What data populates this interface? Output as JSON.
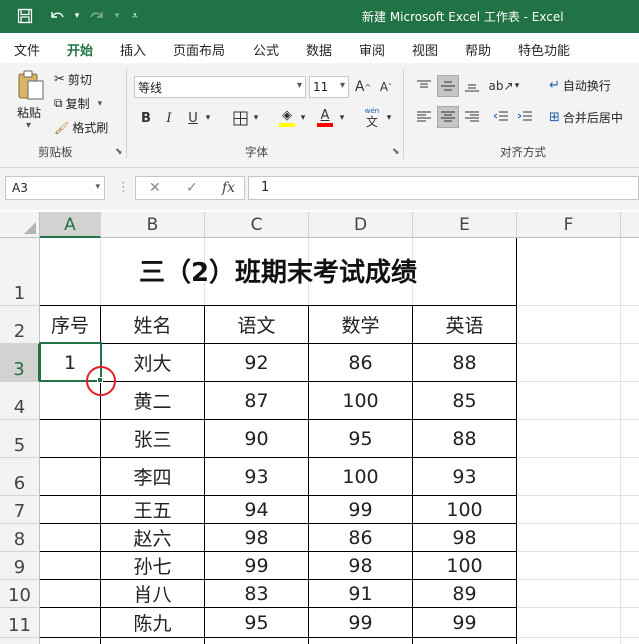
{
  "window": {
    "title": "新建 Microsoft Excel 工作表  -  Excel",
    "qat": {
      "save_icon": "save-icon",
      "undo_icon": "undo-icon",
      "redo_icon": "redo-icon",
      "more_icon": "customize-qat-icon"
    }
  },
  "menu": {
    "tabs": [
      "文件",
      "开始",
      "插入",
      "页面布局",
      "公式",
      "数据",
      "审阅",
      "视图",
      "帮助",
      "特色功能"
    ],
    "active": "开始"
  },
  "ribbon": {
    "clipboard": {
      "paste": "粘贴",
      "cut": "剪切",
      "copy": "复制",
      "format_painter": "格式刷",
      "label": "剪贴板"
    },
    "font": {
      "name": "等线",
      "size": "11",
      "grow": "A",
      "shrink": "A",
      "bold": "B",
      "italic": "I",
      "underline": "U",
      "fill_a": "A",
      "font_a": "A",
      "wen": "wén",
      "wen_char": "文",
      "label": "字体"
    },
    "alignment": {
      "wrap_text": "自动换行",
      "merge_center": "合并后居中",
      "label": "对齐方式"
    },
    "colors": {
      "fill": "#ffff00",
      "font": "#ff0000",
      "accent": "#217346"
    }
  },
  "formula_bar": {
    "name_box": "A3",
    "cancel": "✕",
    "enter": "✓",
    "fx": "fx",
    "value": "1"
  },
  "grid": {
    "columns": [
      "A",
      "B",
      "C",
      "D",
      "E",
      "F"
    ],
    "rows": [
      "1",
      "2",
      "3",
      "4",
      "5",
      "6",
      "7",
      "8",
      "9",
      "10",
      "11"
    ],
    "selected_cell": "A3"
  },
  "table": {
    "title": "三（2）班期末考试成绩",
    "headers": [
      "序号",
      "姓名",
      "语文",
      "数学",
      "英语"
    ],
    "rows": [
      [
        "1",
        "刘大",
        "92",
        "86",
        "88"
      ],
      [
        "",
        "黄二",
        "87",
        "100",
        "85"
      ],
      [
        "",
        "张三",
        "90",
        "95",
        "88"
      ],
      [
        "",
        "李四",
        "93",
        "100",
        "93"
      ],
      [
        "",
        "王五",
        "94",
        "99",
        "100"
      ],
      [
        "",
        "赵六",
        "98",
        "86",
        "98"
      ],
      [
        "",
        "孙七",
        "99",
        "98",
        "100"
      ],
      [
        "",
        "肖八",
        "83",
        "91",
        "89"
      ],
      [
        "",
        "陈九",
        "95",
        "99",
        "99"
      ]
    ]
  }
}
